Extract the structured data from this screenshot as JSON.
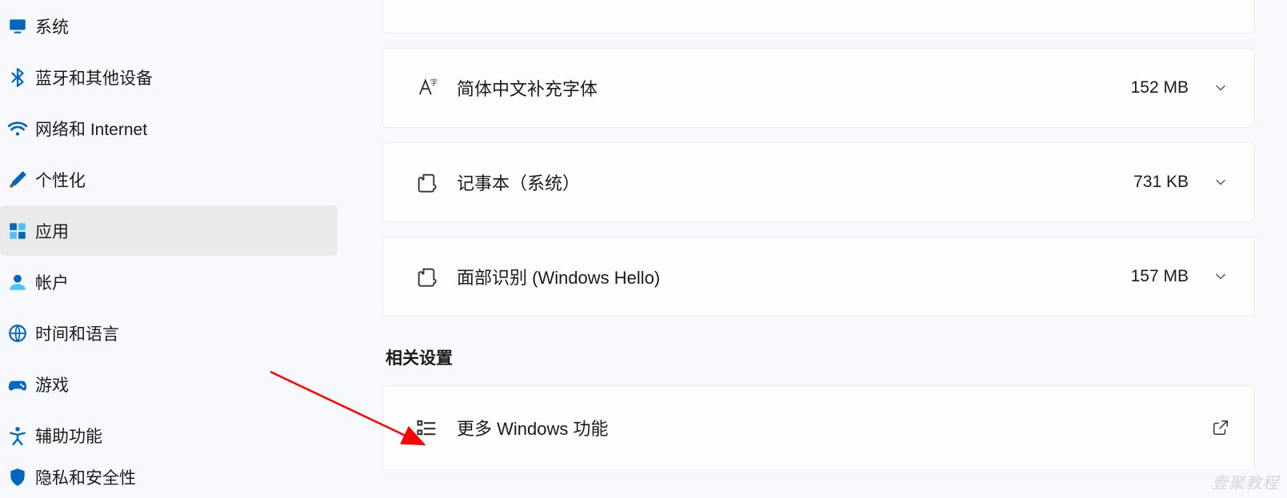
{
  "sidebar": {
    "items": [
      {
        "label": "系统",
        "icon": "system"
      },
      {
        "label": "蓝牙和其他设备",
        "icon": "bluetooth"
      },
      {
        "label": "网络和 Internet",
        "icon": "network"
      },
      {
        "label": "个性化",
        "icon": "personalization"
      },
      {
        "label": "应用",
        "icon": "apps",
        "active": true
      },
      {
        "label": "帐户",
        "icon": "accounts"
      },
      {
        "label": "时间和语言",
        "icon": "time-language"
      },
      {
        "label": "游戏",
        "icon": "gaming"
      },
      {
        "label": "辅助功能",
        "icon": "accessibility"
      },
      {
        "label": "隐私和安全性",
        "icon": "privacy"
      }
    ]
  },
  "features": [
    {
      "label": "简体中文补充字体",
      "size": "152 MB",
      "icon": "font"
    },
    {
      "label": "记事本（系统）",
      "size": "731 KB",
      "icon": "piece"
    },
    {
      "label": "面部识别 (Windows Hello)",
      "size": "157 MB",
      "icon": "piece"
    }
  ],
  "related": {
    "heading": "相关设置",
    "items": [
      {
        "label": "更多 Windows 功能",
        "icon": "list",
        "action": "open-external"
      }
    ]
  },
  "watermark": "壹聚教程"
}
